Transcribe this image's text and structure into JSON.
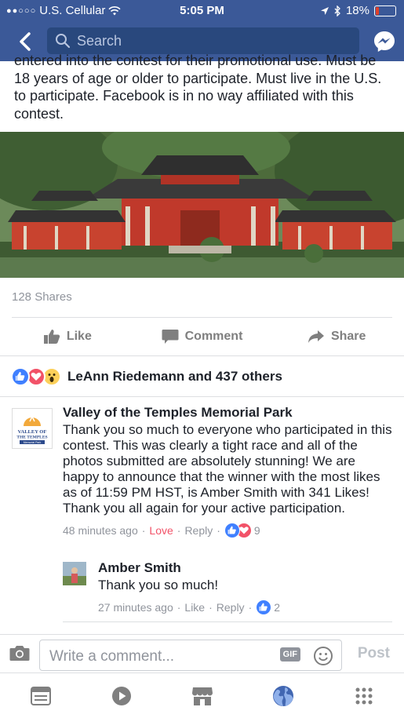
{
  "status": {
    "carrier": "U.S. Cellular",
    "time": "5:05 PM",
    "battery": "18%",
    "battery_level": 0.18
  },
  "nav": {
    "search_placeholder": "Search"
  },
  "post": {
    "text": "entered into the contest for their promotional use. Must be 18 years of age or older to participate. Must live in the U.S. to participate. Facebook is in no way affiliated with this contest.",
    "shares": "128 Shares",
    "actions": {
      "like": "Like",
      "comment": "Comment",
      "share": "Share"
    },
    "reactions_text": "LeAnn Riedemann and 437 others"
  },
  "comment": {
    "author": "Valley of the Temples Memorial Park",
    "logo_text": [
      "VALLEY OF",
      "THE TEMPLES",
      "Memorial Park"
    ],
    "text": "Thank you so much to everyone who participated in this contest. This was clearly a tight race and all of the photos submitted are absolutely stunning! We are happy to announce that the winner with the most likes as of 11:59 PM HST,  is Amber Smith with 341 Likes!  Thank you all again for your active participation.",
    "time": "48 minutes ago",
    "love_label": "Love",
    "reply_label": "Reply",
    "reaction_count": "9"
  },
  "reply": {
    "author": "Amber Smith",
    "text": "Thank you so much!",
    "time": "27 minutes ago",
    "like_label": "Like",
    "reply_label": "Reply",
    "reaction_count": "2"
  },
  "composer": {
    "placeholder": "Write a comment...",
    "gif_label": "GIF",
    "post_label": "Post"
  },
  "colors": {
    "brand": "#3b5998",
    "love": "#f25268",
    "like": "#4080ff"
  }
}
